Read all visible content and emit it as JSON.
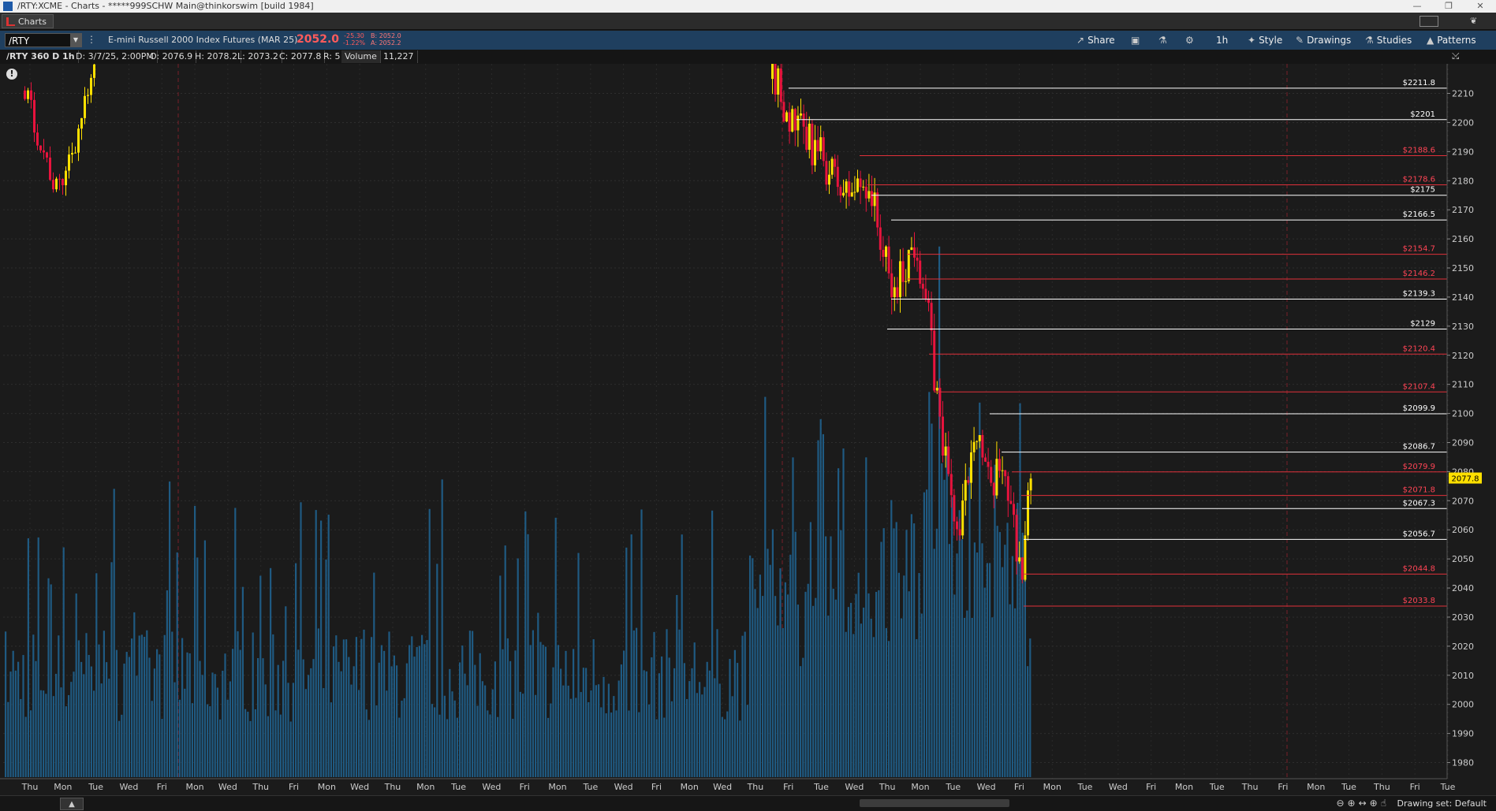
{
  "window": {
    "title": "/RTY:XCME - Charts - *****999SCHW Main@thinkorswim [build 1984]",
    "tab_label": "Charts"
  },
  "toolbar": {
    "symbol": "/RTY",
    "description": "E-mini Russell 2000 Index Futures (MAR 25)",
    "last_price": "2052.0",
    "change": "-25.30",
    "change_pct": "-1.22%",
    "bid": "B: 2052.0",
    "ask": "A: 2052.2",
    "buttons": {
      "share": "Share",
      "timeframe": "1h",
      "style": "Style",
      "drawings": "Drawings",
      "studies": "Studies",
      "patterns": "Patterns"
    }
  },
  "infobar": {
    "chart_label": "/RTY 360 D 1h",
    "date": "D: 3/7/25, 2:00PM",
    "open": "O: 2076.9",
    "high": "H: 2078.2",
    "low": "L: 2073.2",
    "close": "C: 2077.8",
    "range": "R: 5",
    "volume_label": "Volume",
    "volume_value": "11,227"
  },
  "footer": {
    "drawing_set": "Drawing set: Default"
  },
  "colors": {
    "background": "#1b1b1b",
    "up_candle": "#ffe000",
    "down_candle": "#e8133d",
    "volume": "#1f5a82",
    "support_line": "#ffffff",
    "resistance_line": "#e0303a",
    "current_price_tag": "#ffe000"
  },
  "chart_data": {
    "type": "candlestick",
    "symbol": "/RTY",
    "aggregation": "1h",
    "ylim": [
      1975,
      2218
    ],
    "y_ticks": [
      2210,
      2200,
      2190,
      2180,
      2170,
      2160,
      2150,
      2140,
      2130,
      2120,
      2110,
      2100,
      2090,
      2080,
      2070,
      2060,
      2050,
      2040,
      2030,
      2020,
      2010,
      2000,
      1990,
      1980
    ],
    "x_ticks": [
      "Thu",
      "Mon",
      "Tue",
      "Wed",
      "Fri",
      "Mon",
      "Wed",
      "Thu",
      "Fri",
      "Mon",
      "Wed",
      "Thu",
      "Mon",
      "Tue",
      "Wed",
      "Fri",
      "Mon",
      "Tue",
      "Wed",
      "Fri",
      "Mon",
      "Wed",
      "Thu",
      "Fri",
      "Tue",
      "Wed",
      "Thu",
      "Mon",
      "Tue",
      "Wed",
      "Fri",
      "Mon",
      "Tue",
      "Wed",
      "Fri",
      "Mon",
      "Tue",
      "Thu",
      "Fri",
      "Mon",
      "Tue",
      "Thu",
      "Fri",
      "Tue"
    ],
    "current_price": 2077.8,
    "current_price_label": "2077.8",
    "levels": [
      {
        "label": "$2211.8",
        "value": 2211.8,
        "kind": "white"
      },
      {
        "label": "$2201",
        "value": 2201,
        "kind": "white"
      },
      {
        "label": "$2188.6",
        "value": 2188.6,
        "kind": "red"
      },
      {
        "label": "$2178.6",
        "value": 2178.6,
        "kind": "red"
      },
      {
        "label": "$2175",
        "value": 2175,
        "kind": "white"
      },
      {
        "label": "$2166.5",
        "value": 2166.5,
        "kind": "white"
      },
      {
        "label": "$2154.7",
        "value": 2154.7,
        "kind": "red"
      },
      {
        "label": "$2146.2",
        "value": 2146.2,
        "kind": "red"
      },
      {
        "label": "$2139.3",
        "value": 2139.3,
        "kind": "white"
      },
      {
        "label": "$2129",
        "value": 2129,
        "kind": "white"
      },
      {
        "label": "$2120.4",
        "value": 2120.4,
        "kind": "red"
      },
      {
        "label": "$2107.4",
        "value": 2107.4,
        "kind": "red"
      },
      {
        "label": "$2099.9",
        "value": 2099.9,
        "kind": "white"
      },
      {
        "label": "$2086.7",
        "value": 2086.7,
        "kind": "white"
      },
      {
        "label": "$2079.9",
        "value": 2079.9,
        "kind": "red"
      },
      {
        "label": "$2071.8",
        "value": 2071.8,
        "kind": "red"
      },
      {
        "label": "$2067.3",
        "value": 2067.3,
        "kind": "white"
      },
      {
        "label": "$2056.7",
        "value": 2056.7,
        "kind": "white"
      },
      {
        "label": "$2044.8",
        "value": 2044.8,
        "kind": "red"
      },
      {
        "label": "$2033.8",
        "value": 2033.8,
        "kind": "red"
      }
    ]
  }
}
